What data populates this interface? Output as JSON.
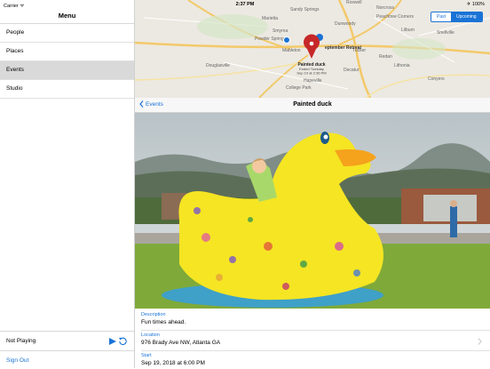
{
  "status_bar": {
    "carrier": "Carrier ᯤ",
    "time": "2:37 PM",
    "battery": "✈ 100%"
  },
  "sidebar": {
    "title": "Menu",
    "items": [
      {
        "label": "People",
        "selected": false
      },
      {
        "label": "Places",
        "selected": false
      },
      {
        "label": "Events",
        "selected": true
      },
      {
        "label": "Studio",
        "selected": false
      }
    ],
    "player": {
      "status": "Not Playing"
    },
    "sign_out": "Sign Out"
  },
  "map": {
    "toggle": {
      "past": "Past",
      "upcoming": "Upcoming",
      "selected": "Upcoming"
    },
    "places": [
      "Sandy Springs",
      "Peachtree Corners",
      "Roswell",
      "Marietta",
      "Smyrna",
      "Powder Springs",
      "Mableton",
      "Douglasville",
      "Tucker",
      "Dunwoody",
      "Norcross",
      "Lilburn",
      "Snellville",
      "Lithonia",
      "Conyers",
      "Decatur",
      "Redan",
      "College Park",
      "Hapeville"
    ],
    "pin_callout": {
      "title": "Painted duck",
      "line2": "Ended Tuesday",
      "line3": "Sep 19 at 2:36 PM"
    },
    "other_event_label": "eptember Retreat",
    "accent": "#1a73d6",
    "pin_color": "#c62828"
  },
  "nav": {
    "back_label": "Events",
    "title": "Painted duck"
  },
  "details": {
    "description_label": "Description",
    "description": "Fun times ahead.",
    "location_label": "Location",
    "location": "976 Brady Ave NW, Atlanta GA",
    "start_label": "Start",
    "start": "Sep 19, 2018 at 6:00 PM"
  }
}
